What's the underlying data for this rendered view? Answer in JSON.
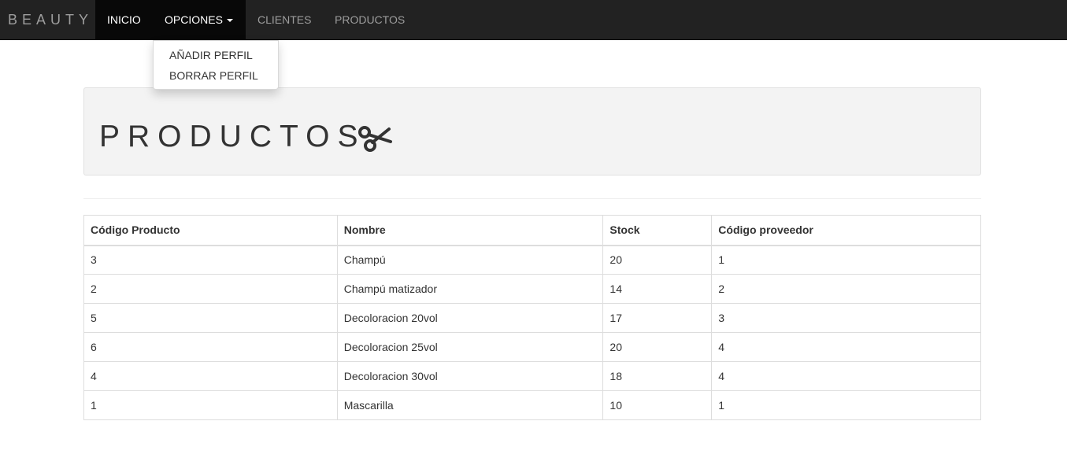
{
  "navbar": {
    "brand": "BEAUTY",
    "items": [
      {
        "label": "INICIO"
      },
      {
        "label": "OPCIONES"
      },
      {
        "label": "CLIENTES"
      },
      {
        "label": "PRODUCTOS"
      }
    ]
  },
  "dropdown": {
    "items": [
      {
        "label": "AÑADIR PERFIL"
      },
      {
        "label": "BORRAR PERFIL"
      }
    ]
  },
  "jumbotron": {
    "title": "PRODUCTOS",
    "icon": "scissors-icon"
  },
  "table": {
    "headers": [
      "Código Producto",
      "Nombre",
      "Stock",
      "Código proveedor"
    ],
    "rows": [
      [
        "3",
        "Champú",
        "20",
        "1"
      ],
      [
        "2",
        "Champú matizador",
        "14",
        "2"
      ],
      [
        "5",
        "Decoloracion 20vol",
        "17",
        "3"
      ],
      [
        "6",
        "Decoloracion 25vol",
        "20",
        "4"
      ],
      [
        "4",
        "Decoloracion 30vol",
        "18",
        "4"
      ],
      [
        "1",
        "Mascarilla",
        "10",
        "1"
      ]
    ]
  },
  "colors": {
    "navbar_bg": "#222222",
    "active_bg": "#080808",
    "jumbotron_bg": "#f3f3f3"
  }
}
